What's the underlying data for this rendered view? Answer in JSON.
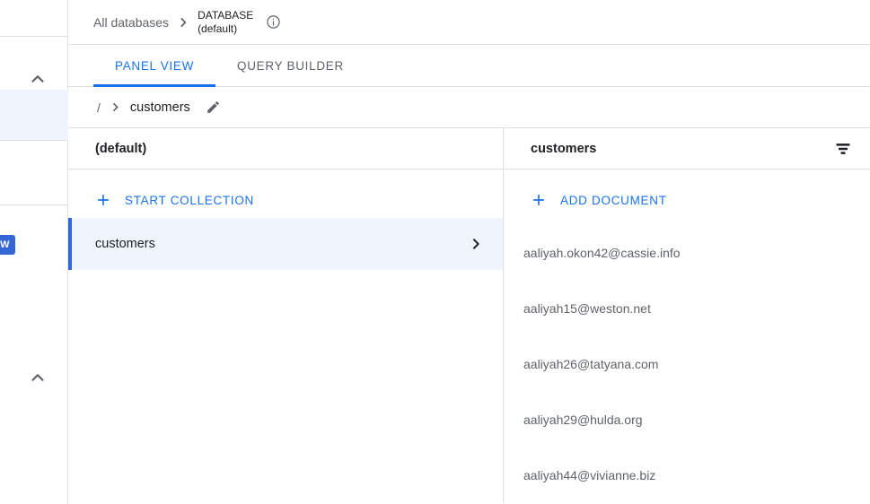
{
  "left_rail": {
    "collapse_top_label": "chevron-up",
    "collapse_bottom_label": "chevron-up",
    "badge_label": "NEW"
  },
  "db_header": {
    "all_databases_label": "All databases",
    "separator": "chevron-right",
    "database_label_line1": "DATABASE",
    "database_label_line2": "(default)",
    "info_icon": "info-icon"
  },
  "tabs": [
    {
      "label": "PANEL VIEW",
      "active": true
    },
    {
      "label": "QUERY BUILDER",
      "active": false
    }
  ],
  "path_bar": {
    "root": "/",
    "separator": "chevron-right",
    "current": "customers",
    "edit_icon": "pencil-icon"
  },
  "collections_panel": {
    "title": "(default)",
    "action_label": "START COLLECTION",
    "action_icon": "plus-icon",
    "rows": [
      {
        "name": "customers",
        "selected": true,
        "chevron": "chevron-right"
      }
    ]
  },
  "documents_panel": {
    "title": "customers",
    "filter_icon": "filter-icon",
    "action_label": "ADD DOCUMENT",
    "action_icon": "plus-icon",
    "documents": [
      "aaliyah.okon42@cassie.info",
      "aaliyah15@weston.net",
      "aaliyah26@tatyana.com",
      "aaliyah29@hulda.org",
      "aaliyah44@vivianne.biz"
    ]
  },
  "colors": {
    "accent_blue": "#1a73e8",
    "selected_blue": "#3367d6",
    "selected_bg": "#f0f4fd",
    "text_primary": "#202124",
    "text_secondary": "#5f6368",
    "border": "#e0e0e0"
  }
}
